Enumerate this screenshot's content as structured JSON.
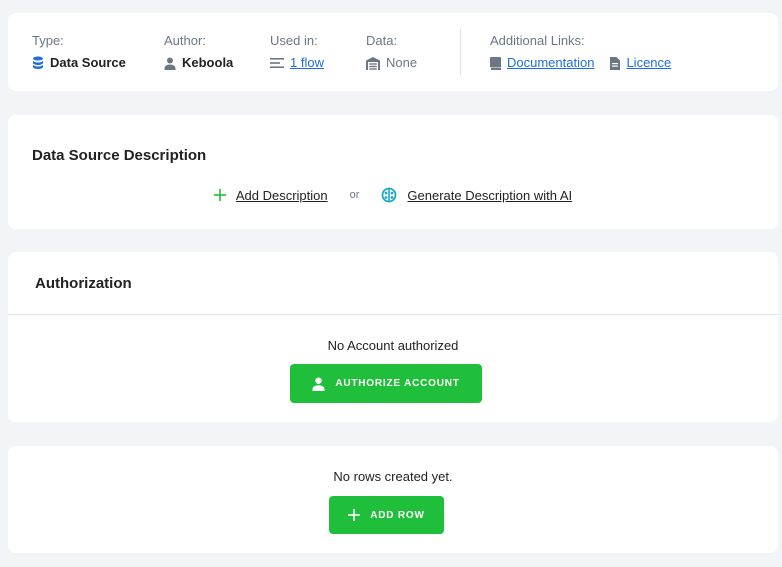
{
  "meta": {
    "type_label": "Type:",
    "type_value": "Data Source",
    "author_label": "Author:",
    "author_value": "Keboola",
    "used_in_label": "Used in:",
    "used_in_value": "1 flow",
    "data_label": "Data:",
    "data_value": "None",
    "links_label": "Additional Links:",
    "documentation_link": "Documentation",
    "licence_link": "Licence"
  },
  "description": {
    "title": "Data Source Description",
    "add_label": "Add Description",
    "or_label": "or",
    "generate_label": "Generate Description with AI"
  },
  "authorization": {
    "title": "Authorization",
    "status": "No Account authorized",
    "button_label": "AUTHORIZE ACCOUNT"
  },
  "rows": {
    "status": "No rows created yet.",
    "button_label": "ADD ROW"
  },
  "colors": {
    "accent_green": "#1fbf3b",
    "link_blue": "#1e6fd9",
    "ai_teal": "#1aa9c4",
    "muted_text": "#6b7785"
  }
}
